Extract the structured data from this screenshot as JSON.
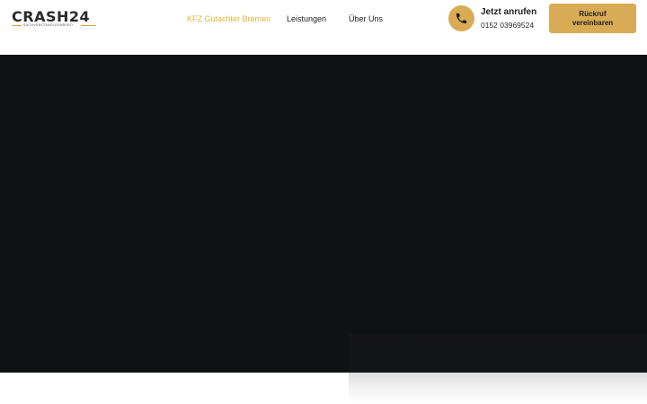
{
  "header": {
    "logo": {
      "text": "CRASH24",
      "tagline": "SACHVERSTÄNDIGENBÜRO"
    },
    "nav": [
      {
        "label": "KFZ Gutachter Bremen",
        "active": true
      },
      {
        "label": "Leistungen",
        "active": false
      },
      {
        "label": "Über Uns",
        "active": false
      }
    ],
    "call": {
      "icon": "phone-icon",
      "title": "Jetzt anrufen",
      "number": "0152 03969524"
    },
    "callback_button": "Rückruf vereinbaren"
  },
  "colors": {
    "accent": "#d9ab55",
    "nav_active": "#e2b33c",
    "hero_background": "#101113",
    "text": "#222222"
  }
}
